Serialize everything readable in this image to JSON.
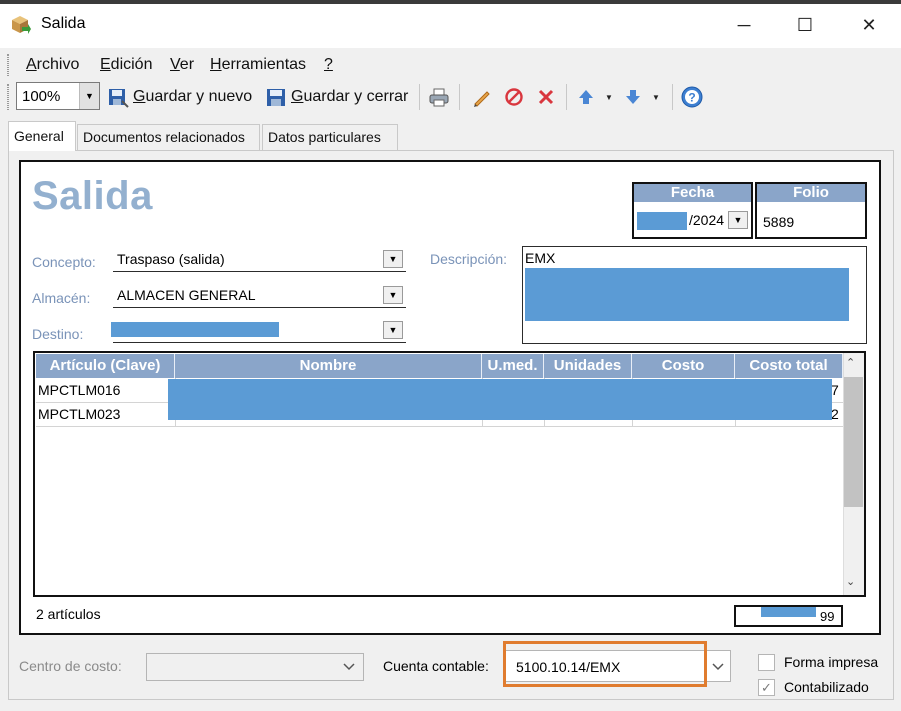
{
  "window": {
    "title": "Salida",
    "minimize_glyph": "─",
    "maximize_glyph": "☐",
    "close_glyph": "✕"
  },
  "menu": {
    "archivo": {
      "u": "A",
      "rest": "rchivo"
    },
    "edicion": {
      "u": "E",
      "rest": "dición"
    },
    "ver": {
      "u": "V",
      "rest": "er"
    },
    "herramientas": {
      "u": "H",
      "rest": "erramientas"
    },
    "help": {
      "u": "?",
      "rest": ""
    }
  },
  "toolbar": {
    "zoom_value": "100%",
    "guardar_nuevo": {
      "u": "G",
      "rest": "uardar y nuevo"
    },
    "guardar_cerrar": {
      "u": "G",
      "rest": "uardar y cerrar"
    },
    "icons": [
      "save-new-icon",
      "save-close-icon",
      "print-icon",
      "edit-pencil-icon",
      "cancel-icon",
      "delete-icon",
      "arrow-up-icon",
      "arrow-down-icon",
      "help-icon"
    ]
  },
  "tabs": [
    "General",
    "Documentos relacionados",
    "Datos particulares"
  ],
  "form": {
    "heading": "Salida",
    "fecha": {
      "label": "Fecha",
      "value": "/2024"
    },
    "folio": {
      "label": "Folio",
      "value": "5889"
    },
    "concepto": {
      "label": "Concepto:",
      "value": "Traspaso (salida)"
    },
    "almacen": {
      "label": "Almacén:",
      "value": "ALMACEN GENERAL"
    },
    "destino": {
      "label": "Destino:",
      "value": ""
    },
    "descripcion": {
      "label": "Descripción:",
      "value": "EMX"
    }
  },
  "grid": {
    "headers": [
      "Artículo (Clave)",
      "Nombre",
      "U.med.",
      "Unidades",
      "Costo",
      "Costo total"
    ],
    "rows": [
      {
        "clave": "MPCTLM016",
        "total_tail": "7"
      },
      {
        "clave": "MPCTLM023",
        "total_tail": "2"
      }
    ],
    "count_text": "2 artículos",
    "total_tail": "99"
  },
  "bottom": {
    "centro_costo_label": "Centro de costo:",
    "centro_costo_value": "",
    "cuenta_contable_label": "Cuenta contable:",
    "cuenta_contable_value": "5100.10.14/EMX",
    "forma_impresa_label": "Forma impresa",
    "forma_impresa_checked": false,
    "contabilizado_label": "Contabilizado",
    "contabilizado_checked": true
  },
  "colors": {
    "header_blue": "#8aa5c9",
    "label_blue": "#7a93b8",
    "title_blue": "#93b0cf",
    "redaction": "#5b9bd5",
    "highlight_orange": "#e07c2f"
  }
}
